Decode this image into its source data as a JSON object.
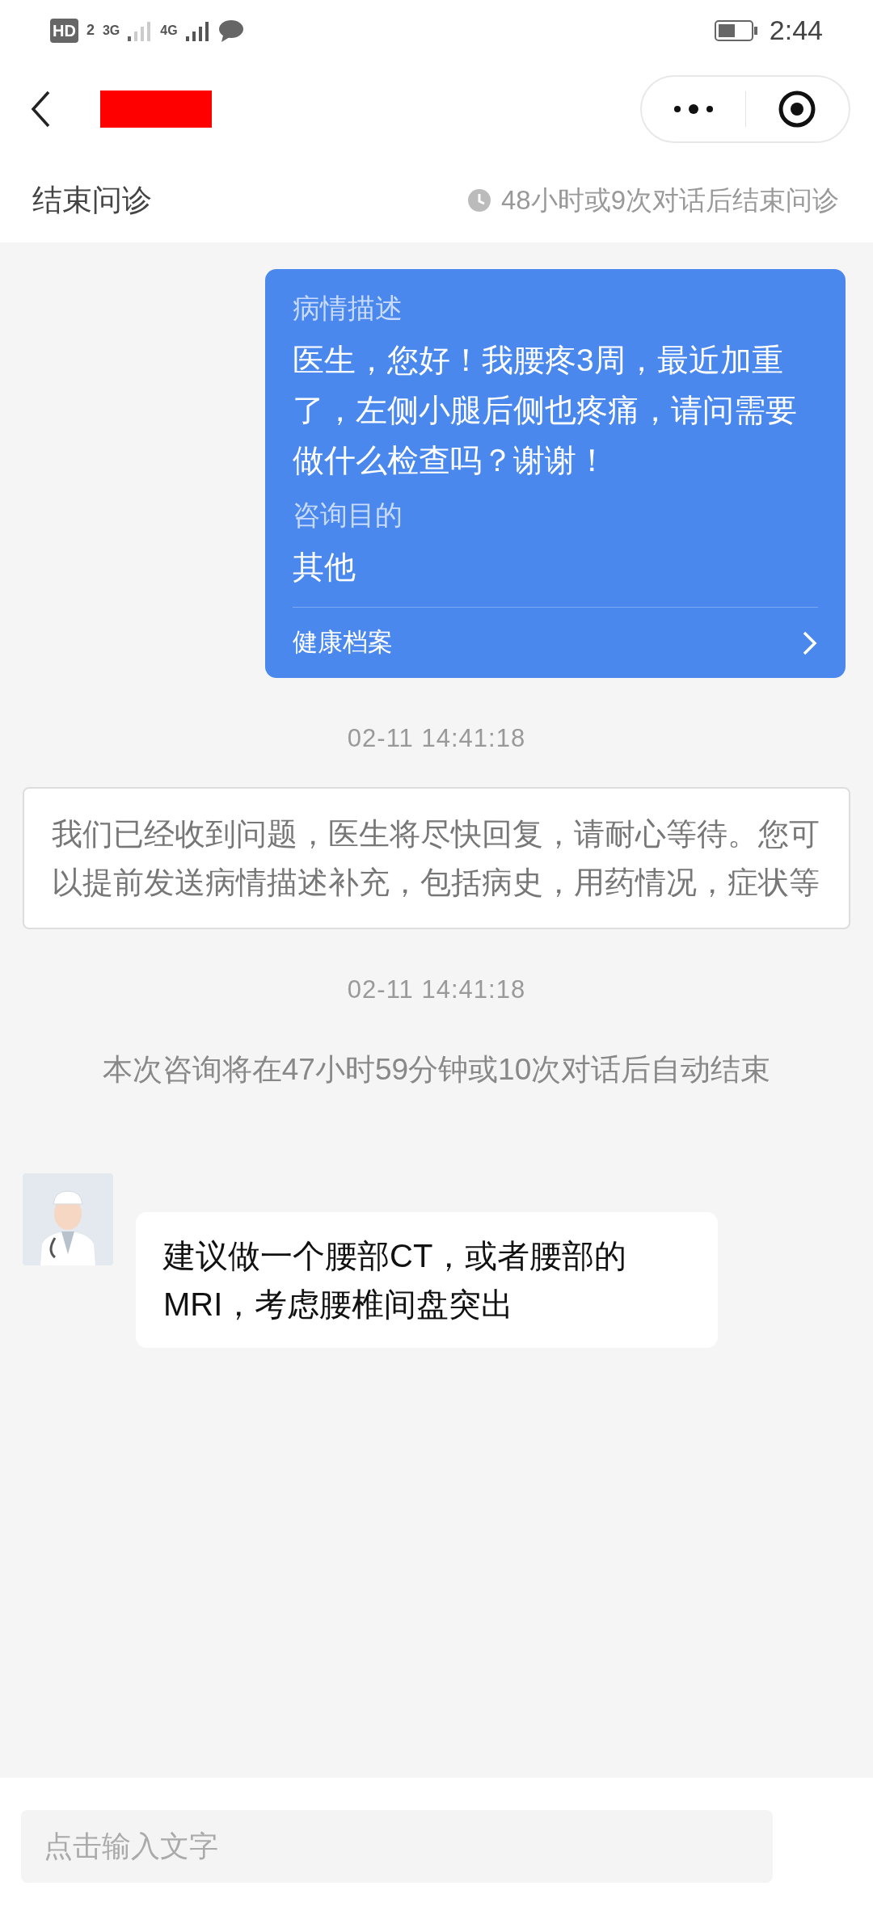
{
  "status_bar": {
    "hd": "HD",
    "sim": "2",
    "net1": "3G",
    "net2": "4G",
    "time": "2:44"
  },
  "header": {
    "redacted": true
  },
  "consult_bar": {
    "title": "结束问诊",
    "note": "48小时或9次对话后结束问诊"
  },
  "messages": [
    {
      "kind": "user_card",
      "sections": [
        {
          "label": "病情描述",
          "text": "医生，您好！我腰疼3周，最近加重了，左侧小腿后侧也疼痛，请问需要做什么检查吗？谢谢！"
        },
        {
          "label": "咨询目的",
          "text": "其他"
        }
      ],
      "link": "健康档案"
    },
    {
      "kind": "timestamp",
      "text": "02-11 14:41:18"
    },
    {
      "kind": "system_card",
      "text": "我们已经收到问题，医生将尽快回复，请耐心等待。您可以提前发送病情描述补充，包括病史，用药情况，症状等"
    },
    {
      "kind": "timestamp",
      "text": "02-11 14:41:18"
    },
    {
      "kind": "notice",
      "text": "本次咨询将在47小时59分钟或10次对话后自动结束"
    },
    {
      "kind": "doctor_text",
      "text": "建议做一个腰部CT，或者腰部的MRI，考虑腰椎间盘突出"
    }
  ],
  "input": {
    "placeholder": "点击输入文字"
  }
}
